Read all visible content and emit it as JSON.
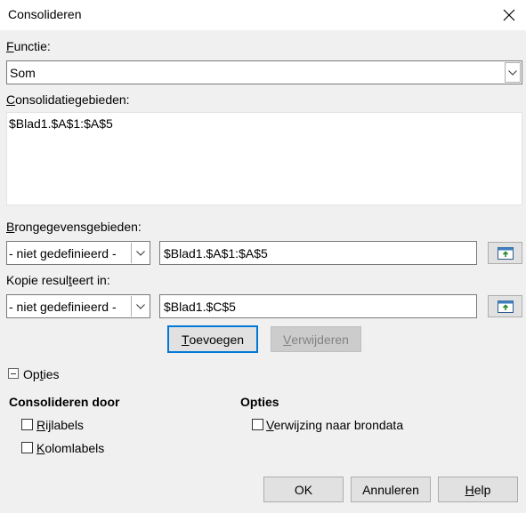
{
  "window": {
    "title": "Consolideren"
  },
  "function": {
    "label_u": "F",
    "label_rest": "unctie:",
    "value": "Som"
  },
  "ranges": {
    "label_u": "C",
    "label_rest": "onsolidatiegebieden:",
    "items": [
      "$Blad1.$A$1:$A$5"
    ]
  },
  "source": {
    "label_u": "B",
    "label_rest": "rongegevensgebieden:",
    "combo_value": "- niet gedefinieerd -",
    "field_value": "$Blad1.$A$1:$A$5"
  },
  "copy": {
    "label_pre": "Kopie resul",
    "label_u": "t",
    "label_post": "eert in:",
    "combo_value": "- niet gedefinieerd -",
    "field_value": "$Blad1.$C$5"
  },
  "buttons": {
    "add": {
      "u": "T",
      "rest": "oevoegen"
    },
    "remove": {
      "u": "V",
      "rest": "erwijderen"
    },
    "ok": "OK",
    "cancel": "Annuleren",
    "help": {
      "u": "H",
      "rest": "elp"
    }
  },
  "options": {
    "expander_pre": "Op",
    "expander_u": "t",
    "expander_post": "ies",
    "consolidate_by": {
      "heading": "Consolideren door",
      "row_labels": {
        "u": "R",
        "rest": "ijlabels",
        "checked": false
      },
      "col_labels": {
        "u": "K",
        "rest": "olomlabels",
        "checked": false
      }
    },
    "opts": {
      "heading": "Opties",
      "link": {
        "u": "V",
        "rest": "erwijzing naar brondata",
        "checked": false
      }
    }
  },
  "colors": {
    "accent": "#0078d7",
    "dialog_bg": "#f0f0f0"
  }
}
